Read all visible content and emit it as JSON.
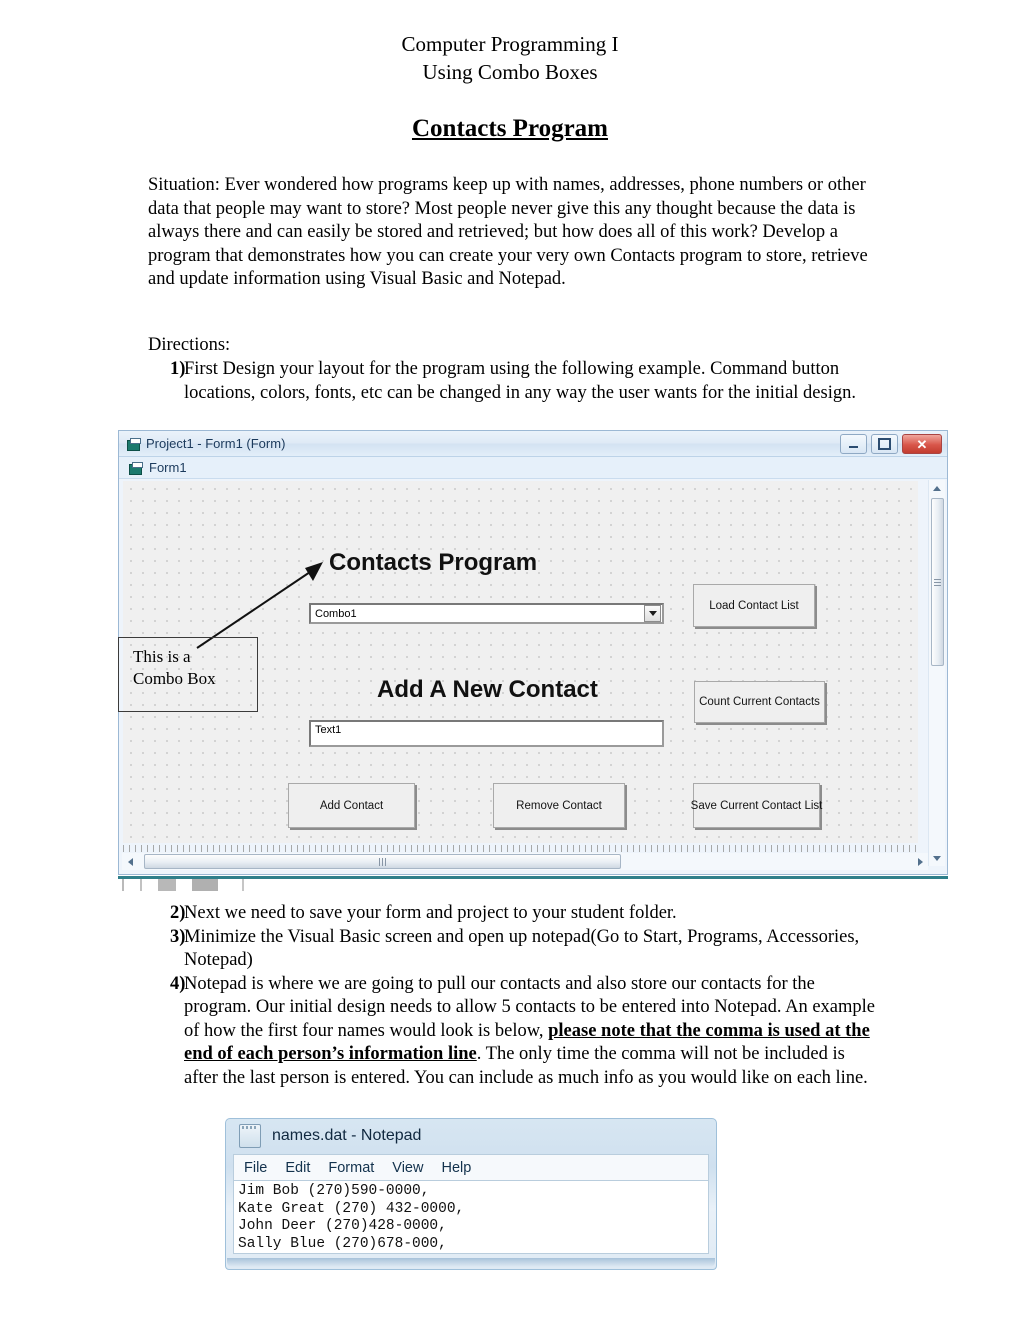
{
  "document": {
    "header_line1": "Computer Programming I",
    "header_line2": "Using Combo Boxes",
    "title": "Contacts Program",
    "situation": "Situation:  Ever wondered how programs keep up with names, addresses, phone numbers or other data that people may want to store?  Most people never give this any thought because the data is always there and can easily be stored and retrieved; but how does all of this work?  Develop a program that demonstrates how you can create your very own Contacts program to store, retrieve and update information using Visual Basic and Notepad.",
    "directions_label": "Directions:",
    "steps": [
      {
        "number": "1)",
        "text": "First Design your layout for the program using the following example.  Command button locations, colors, fonts, etc can be changed in any way the user wants for the initial design."
      },
      {
        "number": "2)",
        "text": "Next we need to save your form and project to your student folder."
      },
      {
        "number": "3)",
        "text": "Minimize the Visual Basic screen and open up notepad(Go to Start, Programs, Accessories, Notepad)"
      },
      {
        "number": "4)",
        "text_before": "Notepad is where we are going to pull our contacts and also store our contacts for the program.  Our initial design needs to allow 5 contacts to be entered into Notepad. An example of how the first four names would look is below, ",
        "text_emphasis": "please note that the comma is used at the end of each person’s information line",
        "text_after": ".  The only time the comma will not be included is after the last person is entered.  You can include as much info as you would like on each line."
      }
    ]
  },
  "vb_window": {
    "titlebar": {
      "title": "Project1 - Form1 (Form)",
      "minimize_label": "",
      "maximize_label": "",
      "close_label": "✕"
    },
    "form_tab": "Form1",
    "form": {
      "heading_contacts": "Contacts Program",
      "heading_add": "Add A New Contact",
      "combo_value": "Combo1",
      "textbox_value": "Text1",
      "buttons": [
        {
          "id": "load",
          "label": "Load Contact List"
        },
        {
          "id": "count",
          "label": "Count Current Contacts"
        },
        {
          "id": "add",
          "label": "Add Contact"
        },
        {
          "id": "remove",
          "label": "Remove Contact"
        },
        {
          "id": "save",
          "label": "Save Current Contact List"
        }
      ]
    },
    "annotation": {
      "line1": "This is a",
      "line2": "Combo Box"
    }
  },
  "notepad": {
    "title": "names.dat - Notepad",
    "menu": [
      "File",
      "Edit",
      "Format",
      "View",
      "Help"
    ],
    "content": "Jim Bob (270)590-0000,\nKate Great (270) 432-0000,\nJohn Deer (270)428-0000,\nSally Blue (270)678-000,"
  },
  "colors": {
    "close_button": "#c23c2f",
    "vb_chrome": "#d3e2f2",
    "form_canvas": "#f0f0f0",
    "notepad_glass": "#cfe0ef"
  }
}
